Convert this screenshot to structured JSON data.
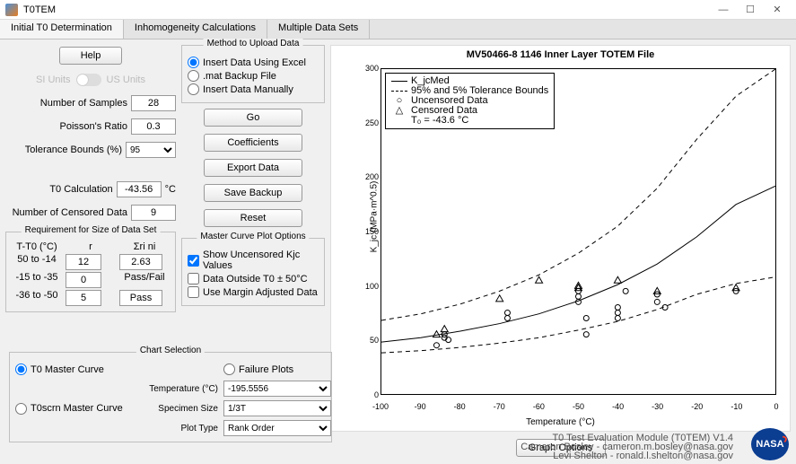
{
  "window": {
    "title": "T0TEM"
  },
  "tabs": {
    "t0": "Initial T0 Determination",
    "t1": "Inhomogeneity Calculations",
    "t2": "Multiple Data Sets"
  },
  "help": "Help",
  "units": {
    "si": "SI Units",
    "us": "US Units"
  },
  "left": {
    "numSamplesLbl": "Number of Samples",
    "numSamples": "28",
    "poissonLbl": "Poisson's Ratio",
    "poisson": "0.3",
    "tolLbl": "Tolerance Bounds (%)",
    "tol": "95",
    "t0calcLbl": "T0 Calculation",
    "t0calc": "-43.56",
    "t0unit": "°C",
    "censLbl": "Number of Censored Data",
    "cens": "9"
  },
  "upload": {
    "title": "Method to Upload Data",
    "r0": "Insert Data Using Excel",
    "r1": ".mat Backup File",
    "r2": "Insert Data Manually",
    "go": "Go",
    "coef": "Coefficients",
    "exp": "Export Data",
    "save": "Save Backup",
    "reset": "Reset"
  },
  "req": {
    "title": "Requirement for Size of Data Set",
    "h0": "T-T0 (°C)",
    "h1": "r",
    "h2": "Σri ni",
    "r0c0": "50 to -14",
    "r0c1": "12",
    "r0c2": "2.63",
    "r1c0": "-15 to -35",
    "r1c1": "0",
    "r1c2": "Pass/Fail",
    "r2c0": "-36 to -50",
    "r2c1": "5",
    "r2c2": "Pass"
  },
  "mcopt": {
    "title": "Master Curve Plot Options",
    "c0": "Show Uncensored Kjc Values",
    "c1": "Data Outside T0 ± 50°C",
    "c2": "Use Margin Adjusted Data"
  },
  "csel": {
    "title": "Chart Selection",
    "r0": "T0 Master Curve",
    "r1": "Failure Plots",
    "r2": "T0scrn Master Curve",
    "tempLbl": "Temperature (°C)",
    "temp": "-195.5556",
    "sizeLbl": "Specimen Size",
    "size": "1/3T",
    "typeLbl": "Plot Type",
    "type": "Rank Order"
  },
  "chart": {
    "title": "MV50466-8 1146 Inner Layer TOTEM File",
    "ylabel": "K_jc (MPa·m^0.5)",
    "xlabel": "Temperature (°C)",
    "graphopt": "Graph Options",
    "legend": {
      "l0": "K_jcMed",
      "l1": "95% and 5% Tolerance Bounds",
      "l2": "Uncensored Data",
      "l3": "Censored Data",
      "l4": "T₀ =   -43.6  °C"
    }
  },
  "footer": {
    "l0": "T0 Test Evaluation Module (T0TEM) V1.4",
    "l1": "Cameron Bosley - cameron.m.bosley@nasa.gov",
    "l2": "Levi Shelton - ronald.l.shelton@nasa.gov"
  },
  "nasa": "NASA",
  "chart_data": {
    "type": "line+scatter",
    "title": "MV50466-8 1146 Inner Layer TOTEM File",
    "xlabel": "Temperature (°C)",
    "ylabel": "Kjc (MPa·m^0.5)",
    "xlim": [
      -100,
      0
    ],
    "ylim": [
      0,
      300
    ],
    "series": [
      {
        "name": "KjcMed",
        "style": "solid",
        "x": [
          -100,
          -90,
          -80,
          -70,
          -60,
          -50,
          -40,
          -30,
          -20,
          -10,
          0
        ],
        "y": [
          48,
          52,
          58,
          65,
          74,
          86,
          101,
          120,
          145,
          175,
          192
        ]
      },
      {
        "name": "95% Tolerance",
        "style": "dashed",
        "x": [
          -100,
          -90,
          -80,
          -70,
          -60,
          -50,
          -40,
          -30,
          -20,
          -10,
          0
        ],
        "y": [
          68,
          74,
          83,
          95,
          110,
          130,
          155,
          190,
          235,
          275,
          300
        ]
      },
      {
        "name": "5% Tolerance",
        "style": "dashed",
        "x": [
          -100,
          -90,
          -80,
          -70,
          -60,
          -50,
          -40,
          -30,
          -20,
          -10,
          0
        ],
        "y": [
          38,
          40,
          43,
          47,
          52,
          59,
          67,
          78,
          92,
          102,
          108
        ]
      }
    ],
    "scatter": [
      {
        "name": "Uncensored",
        "marker": "o",
        "points": [
          [
            -86,
            45
          ],
          [
            -84,
            52
          ],
          [
            -84,
            55
          ],
          [
            -83,
            50
          ],
          [
            -68,
            70
          ],
          [
            -68,
            75
          ],
          [
            -50,
            85
          ],
          [
            -50,
            90
          ],
          [
            -50,
            95
          ],
          [
            -48,
            70
          ],
          [
            -48,
            55
          ],
          [
            -40,
            80
          ],
          [
            -40,
            75
          ],
          [
            -40,
            70
          ],
          [
            -38,
            95
          ],
          [
            -30,
            92
          ],
          [
            -30,
            85
          ],
          [
            -28,
            80
          ],
          [
            -10,
            95
          ]
        ]
      },
      {
        "name": "Censored",
        "marker": "△",
        "points": [
          [
            -86,
            55
          ],
          [
            -84,
            60
          ],
          [
            -70,
            88
          ],
          [
            -60,
            105
          ],
          [
            -50,
            100
          ],
          [
            -50,
            98
          ],
          [
            -40,
            105
          ],
          [
            -30,
            95
          ],
          [
            -10,
            98
          ]
        ]
      }
    ]
  }
}
